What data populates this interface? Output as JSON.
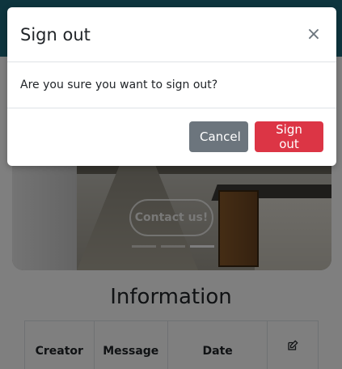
{
  "modal": {
    "title": "Sign out",
    "close_glyph": "×",
    "body_text": "Are you sure you want to sign out?",
    "cancel_label": "Cancel",
    "signout_label": "Sign out"
  },
  "hero": {
    "cta_label": "Contact us!",
    "carousel_indicator_count": 3,
    "active_indicator": 2
  },
  "information": {
    "title": "Information",
    "columns": [
      "Creator",
      "Message",
      "Date"
    ],
    "edit_icon": "edit-icon"
  },
  "colors": {
    "topbar": "#1d6b7c",
    "cancel_button": "#6c757d",
    "signout_button": "#dc3545",
    "backdrop": "rgba(0,0,0,0.5)"
  }
}
